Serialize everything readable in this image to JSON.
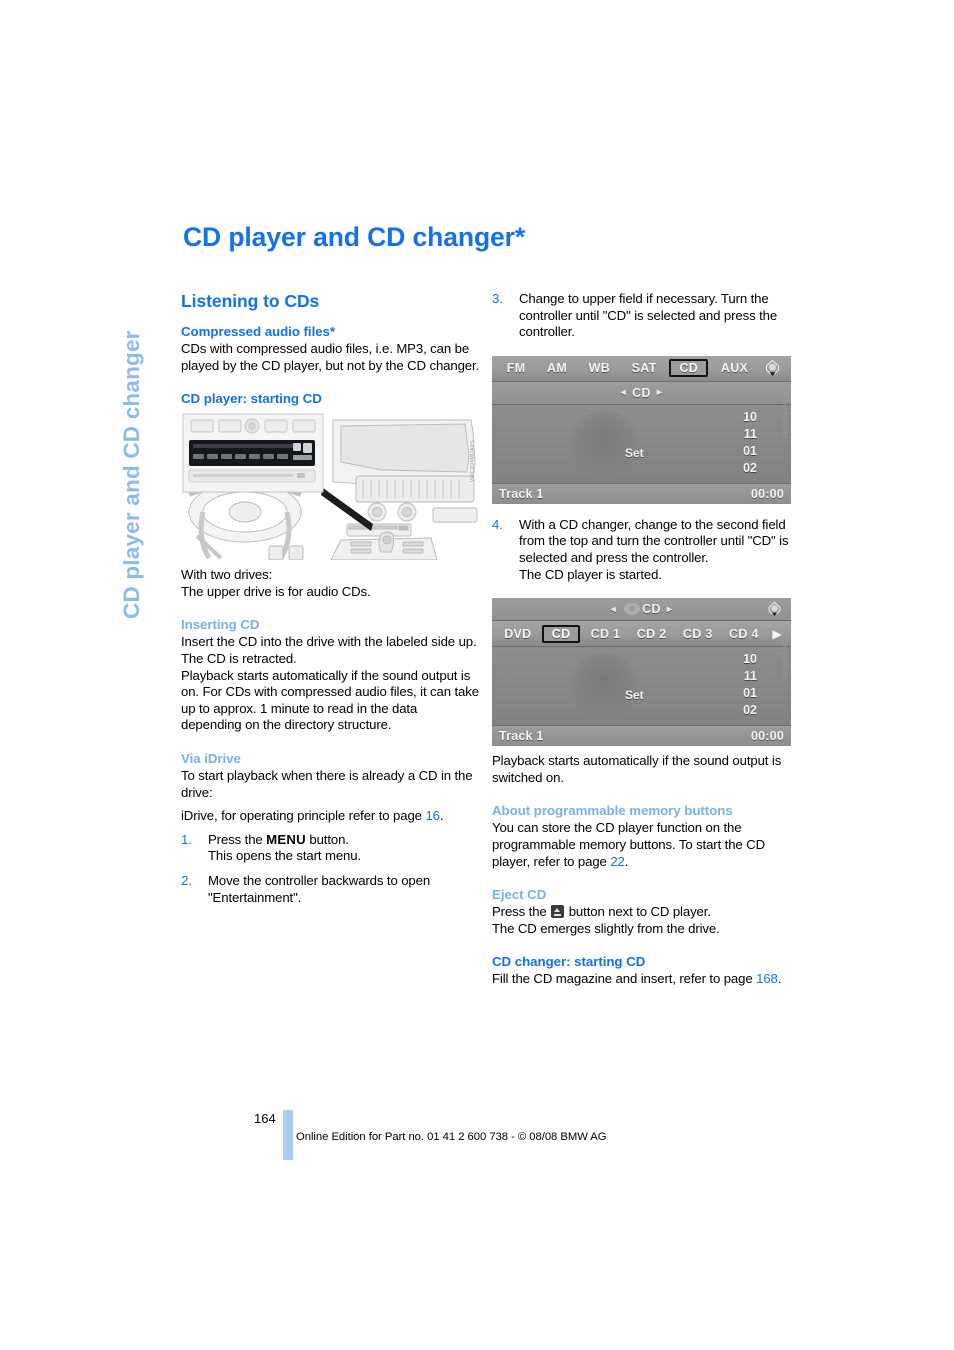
{
  "sidebar": {
    "tab_label": "CD player and CD changer"
  },
  "page_title": "CD player and CD changer*",
  "left_column": {
    "section_heading": "Listening to CDs",
    "compressed": {
      "heading": "Compressed audio files*",
      "body": "CDs with compressed audio files, i.e. MP3, can be played by the CD player, but not by the CD changer."
    },
    "cd_player_starting": {
      "heading": "CD player: starting CD",
      "illustration_name": "car-dashboard-cd-drive-illustration",
      "illustration_code": "VWCD04MUAPS",
      "caption_line1": "With two drives:",
      "caption_line2": "The upper drive is for audio CDs."
    },
    "inserting": {
      "heading": "Inserting CD",
      "body1": "Insert the CD into the drive with the labeled side up. The CD is retracted.",
      "body2": "Playback starts automatically if the sound output is on. For CDs with compressed audio files, it can take up to approx. 1 minute to read in the data depending on the directory structure."
    },
    "via_idrive": {
      "heading": "Via iDrive",
      "body1": "To start playback when there is already a CD in the drive:",
      "body2_pre": "iDrive, for operating principle refer to page ",
      "body2_ref": "16",
      "body2_post": ".",
      "steps": [
        {
          "num": "1.",
          "pre": "Press the ",
          "key": "MENU",
          "post": " button.",
          "line2": "This opens the start menu."
        },
        {
          "num": "2.",
          "pre": "Move the controller backwards to open \"Entertainment\".",
          "key": "",
          "post": "",
          "line2": ""
        }
      ]
    }
  },
  "right_column": {
    "step3": {
      "num": "3.",
      "text": "Change to upper field if necessary. Turn the controller until \"CD\" is selected and press the controller."
    },
    "display1": {
      "name": "idrive-audio-source-display",
      "tabs": [
        "FM",
        "AM",
        "WB",
        "SAT",
        "CD",
        "AUX"
      ],
      "selected_tab": "CD",
      "joystick_icon": "joystick-icon",
      "title_bar": {
        "left_arrow": "◂",
        "label": "CD",
        "right_arrow": "▸"
      },
      "set_label": "Set",
      "numbers": [
        "10",
        "11",
        "01",
        "02"
      ],
      "footer_left": "Track 1",
      "footer_right": "00:00",
      "image_code": "VWCD01MUAPS"
    },
    "step4": {
      "num": "4.",
      "text": "With a CD changer, change to the second field from the top and turn the controller until \"CD\" is selected and press the controller.",
      "line2": "The CD player is started."
    },
    "display2": {
      "name": "idrive-cd-changer-display",
      "title_bar": {
        "left_arrow": "◂",
        "car_icon": "vehicle-icon",
        "label": "CD",
        "right_arrow": "▸"
      },
      "joystick_icon": "joystick-icon",
      "tabs": [
        "DVD",
        "CD",
        "CD 1",
        "CD 2",
        "CD 3",
        "CD 4"
      ],
      "selected_tab": "CD",
      "more_arrow": "▶",
      "set_label": "Set",
      "numbers": [
        "10",
        "11",
        "01",
        "02"
      ],
      "footer_left": "Track 1",
      "footer_right": "00:00",
      "image_code": "VWCD02MUAPS"
    },
    "after_display2": "Playback starts automatically if the sound output is switched on.",
    "memory_buttons": {
      "heading": "About programmable memory buttons",
      "body_pre": "You can store the CD player function on the programmable memory buttons. To start the CD player, refer to page ",
      "body_ref": "22",
      "body_post": "."
    },
    "eject": {
      "heading": "Eject CD",
      "pre": "Press the ",
      "icon": "eject-button-icon",
      "post": " button next to CD player.",
      "line2": "The CD emerges slightly from the drive."
    },
    "cd_changer_starting": {
      "heading": "CD changer: starting CD",
      "body_pre": "Fill the CD magazine and insert, refer to page ",
      "body_ref": "168",
      "body_post": "."
    }
  },
  "footer": {
    "page_number": "164",
    "imprint": "Online Edition for Part no. 01 41 2 600 738 - © 08/08 BMW AG"
  },
  "colors": {
    "accent_blue": "#1570ef",
    "light_blue": "#7ab0e8",
    "tab_blue": "#8cb9ee",
    "folio_bar": "#aacdf2"
  }
}
